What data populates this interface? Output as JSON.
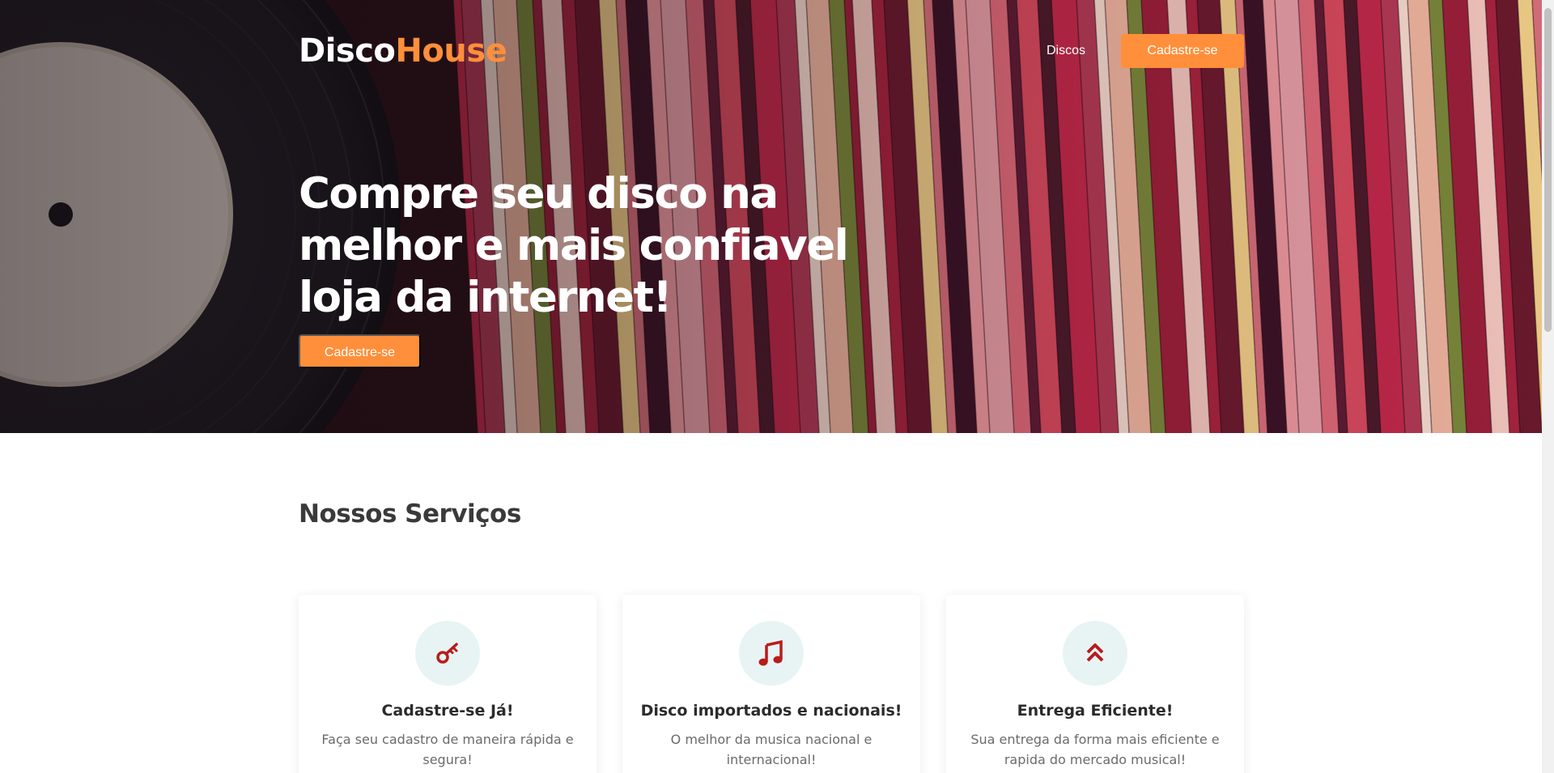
{
  "header": {
    "logo_part1": "Disco",
    "logo_part2": "House",
    "nav_link": "Discos",
    "nav_button": "Cadastre-se"
  },
  "hero": {
    "title": "Compre seu disco na melhor e mais confiavel loja da internet!",
    "button": "Cadastre-se"
  },
  "services": {
    "title": "Nossos Serviços",
    "cards": [
      {
        "icon": "key-icon",
        "title": "Cadastre-se Já!",
        "text": "Faça seu cadastro de maneira rápida e segura!"
      },
      {
        "icon": "music-note-icon",
        "title": "Disco importados e nacionais!",
        "text": "O melhor da musica nacional e internacional!"
      },
      {
        "icon": "double-chevron-up-icon",
        "title": "Entrega Eficiente!",
        "text": "Sua entrega da forma mais eficiente e rapida do mercado musical!"
      }
    ]
  },
  "colors": {
    "accent": "#ff8f3a",
    "icon_color": "#b81c1c",
    "icon_bg": "#e8f4f4"
  }
}
